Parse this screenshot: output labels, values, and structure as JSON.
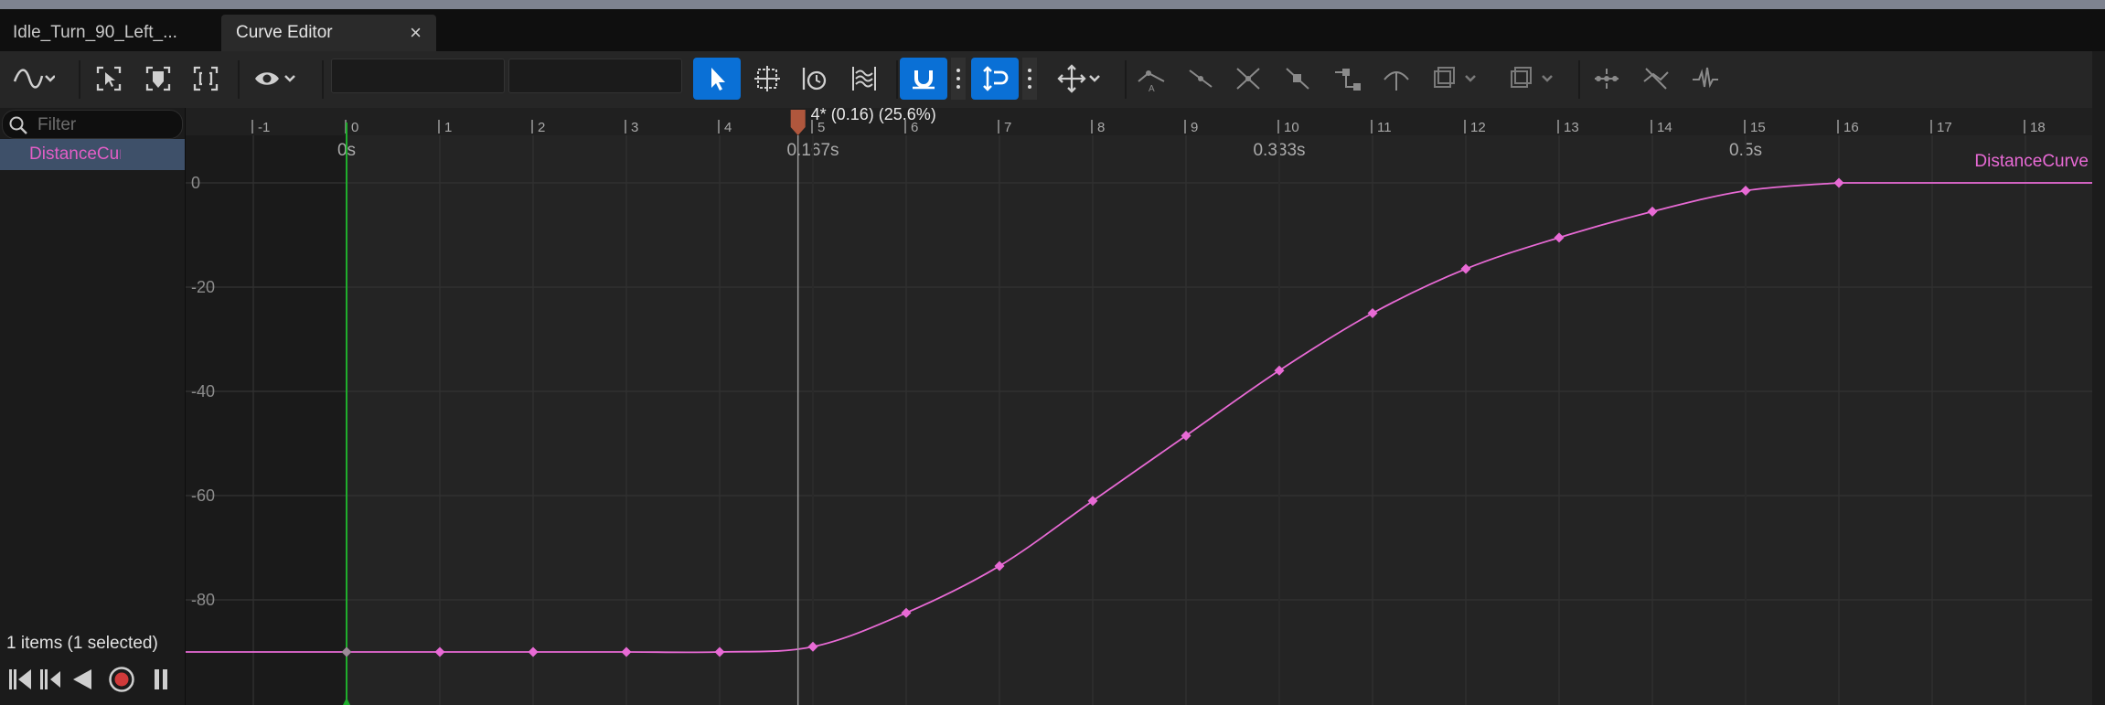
{
  "tabs": [
    {
      "label": "Idle_Turn_90_Left_..."
    },
    {
      "label": "Curve Editor",
      "close": "×"
    }
  ],
  "toolbar": {
    "field1_value": "",
    "field2_value": ""
  },
  "sidebar": {
    "filter_placeholder": "Filter",
    "item_label": "DistanceCurve",
    "status": "1 items (1 selected)"
  },
  "timeline": {
    "frame_labels": [
      "-1",
      "0",
      "1",
      "2",
      "3",
      "4",
      "5",
      "6",
      "7",
      "8",
      "9",
      "10",
      "11",
      "12",
      "13",
      "14",
      "15",
      "16",
      "17",
      "18"
    ],
    "time_labels": [
      "0s",
      "0.167s",
      "0.333s",
      "0.5s"
    ],
    "playhead_label": "4* (0.16) (25.6%)"
  },
  "chart_data": {
    "type": "line",
    "series": [
      {
        "name": "DistanceCurve",
        "color": "#e86ad5",
        "x": [
          0,
          1,
          2,
          3,
          4,
          5,
          6,
          7,
          8,
          9,
          10,
          11,
          12,
          13,
          14,
          15,
          16
        ],
        "y": [
          -90,
          -90,
          -90,
          -90,
          -90,
          -89,
          -82.5,
          -73.5,
          -61,
          -48.5,
          -36,
          -25,
          -16.5,
          -10.5,
          -5.5,
          -1.5,
          0
        ]
      }
    ],
    "x_unit": "frame",
    "y_ticks": [
      "0",
      "-20",
      "-40",
      "-60",
      "-80"
    ],
    "xlim": [
      -1,
      18.5
    ],
    "ylim": [
      -98,
      3
    ],
    "playhead_frame": 4.84,
    "grid": true
  },
  "colors": {
    "accent_blue": "#0a70d6",
    "curve": "#e86ad5",
    "zero_line": "#1fae2c",
    "playhead": "#b0573d"
  }
}
